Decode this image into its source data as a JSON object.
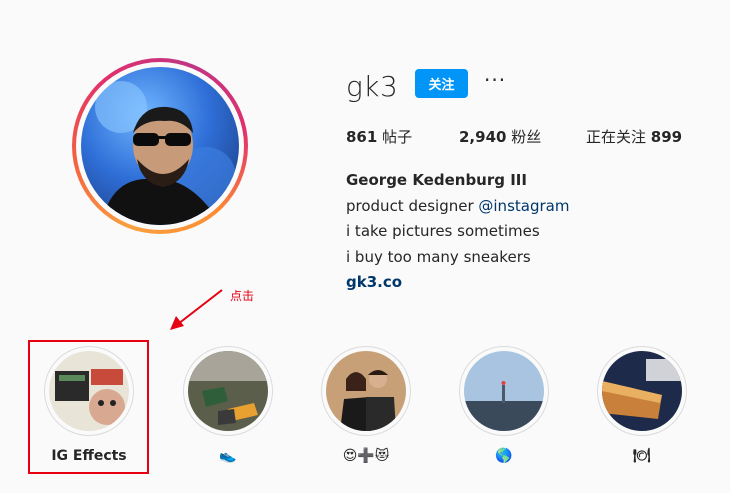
{
  "profile": {
    "username": "gk3",
    "follow_label": "关注",
    "more_label": "···",
    "stats": {
      "posts_count": "861",
      "posts_label": "帖子",
      "followers_count": "2,940",
      "followers_label": "粉丝",
      "following_label": "正在关注",
      "following_count": "899"
    },
    "bio": {
      "full_name": "George Kedenburg III",
      "line1_prefix": "product designer ",
      "line1_mention": "@instagram",
      "line2": "i take pictures sometimes",
      "line3": "i buy too many sneakers",
      "link": "gk3.co"
    }
  },
  "annotation": {
    "label": "点击",
    "color": "#e60012"
  },
  "highlights": [
    {
      "label": "IG Effects"
    },
    {
      "label": "👟"
    },
    {
      "label": "😍➕😻"
    },
    {
      "label": "🌎"
    },
    {
      "label": "🍽"
    }
  ],
  "colors": {
    "accent": "#0095f6",
    "link": "#00376b",
    "annotation_red": "#e60012"
  }
}
